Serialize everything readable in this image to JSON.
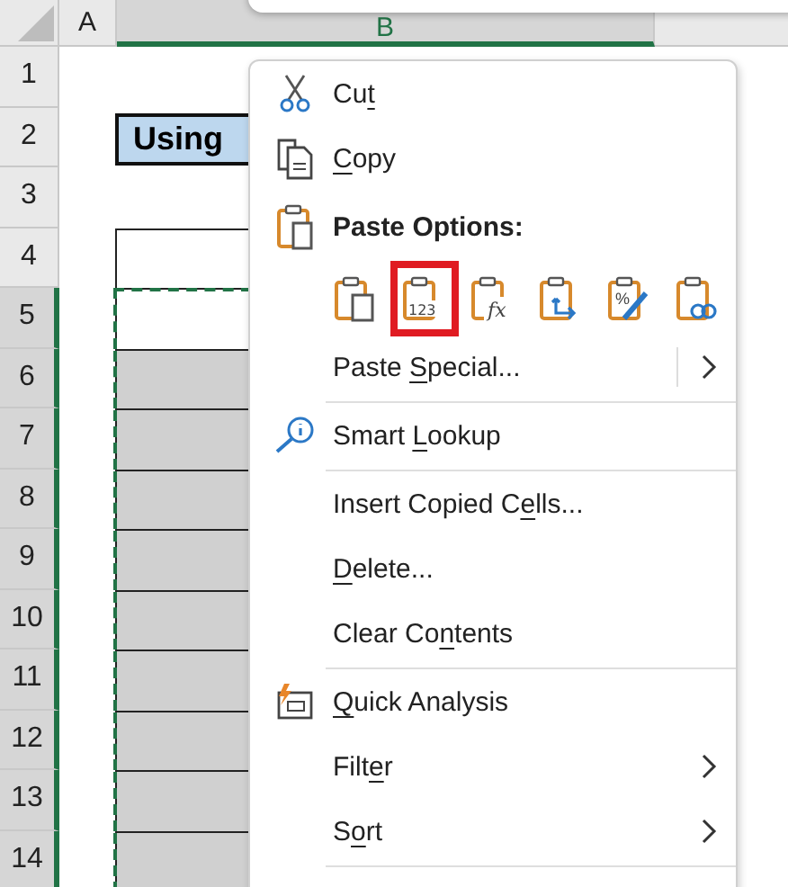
{
  "sheet": {
    "columns": [
      {
        "label": "A",
        "selected": false
      },
      {
        "label": "B",
        "selected": true
      }
    ],
    "rows": [
      {
        "number": "1",
        "selected": false,
        "cell": {
          "kind": "blank"
        }
      },
      {
        "number": "2",
        "selected": false,
        "cell": {
          "kind": "title",
          "text": "Using"
        }
      },
      {
        "number": "3",
        "selected": false,
        "cell": {
          "kind": "blank"
        }
      },
      {
        "number": "4",
        "selected": false,
        "cell": {
          "kind": "outlined"
        }
      },
      {
        "number": "5",
        "selected": true,
        "copied": true,
        "cell": {
          "kind": "outlined"
        }
      },
      {
        "number": "6",
        "selected": true,
        "copied": true,
        "cell": {
          "kind": "shaded"
        }
      },
      {
        "number": "7",
        "selected": true,
        "copied": true,
        "cell": {
          "kind": "shaded"
        }
      },
      {
        "number": "8",
        "selected": true,
        "copied": true,
        "cell": {
          "kind": "shaded"
        }
      },
      {
        "number": "9",
        "selected": true,
        "copied": true,
        "cell": {
          "kind": "shaded"
        }
      },
      {
        "number": "10",
        "selected": true,
        "copied": true,
        "cell": {
          "kind": "shaded"
        }
      },
      {
        "number": "11",
        "selected": true,
        "copied": true,
        "cell": {
          "kind": "shaded"
        }
      },
      {
        "number": "12",
        "selected": true,
        "copied": true,
        "cell": {
          "kind": "shaded"
        }
      },
      {
        "number": "13",
        "selected": true,
        "copied": true,
        "cell": {
          "kind": "shaded"
        }
      },
      {
        "number": "14",
        "selected": true,
        "copied": true,
        "cell": {
          "kind": "shaded"
        }
      }
    ]
  },
  "context_menu": {
    "items": [
      {
        "kind": "command",
        "label": {
          "before": "Cu",
          "key": "t"
        }
      },
      {
        "kind": "command",
        "label": {
          "key": "C",
          "after": "opy"
        }
      },
      {
        "kind": "header",
        "text": "Paste Options:"
      },
      {
        "kind": "paste_icons",
        "options": [
          {
            "selected": false
          },
          {
            "text": "123",
            "selected": true
          },
          {
            "text": "fx",
            "selected": false
          },
          {
            "selected": false
          },
          {
            "text": "%",
            "selected": false
          },
          {
            "selected": false
          }
        ]
      },
      {
        "kind": "command",
        "label": {
          "before": "Paste ",
          "key": "S",
          "after": "pecial..."
        },
        "submenu": true,
        "separator_after": true
      },
      {
        "kind": "command",
        "label": {
          "before": "Smart ",
          "key": "L",
          "after": "ookup"
        },
        "separator_after": true
      },
      {
        "kind": "command",
        "label": {
          "before": "Insert Copied C",
          "key": "e",
          "after": "lls..."
        }
      },
      {
        "kind": "command",
        "label": {
          "key": "D",
          "after": "elete..."
        }
      },
      {
        "kind": "command",
        "label": {
          "before": "Clear Co",
          "key": "n",
          "after": "tents"
        },
        "separator_after": true
      },
      {
        "kind": "command",
        "label": {
          "key": "Q",
          "after": "uick Analysis"
        }
      },
      {
        "kind": "command",
        "label": {
          "before": "Filt",
          "key": "e",
          "after": "r"
        },
        "submenu": true
      },
      {
        "kind": "command",
        "label": {
          "before": "S",
          "key": "o",
          "after": "rt"
        },
        "submenu": true,
        "separator_after": true
      }
    ]
  }
}
